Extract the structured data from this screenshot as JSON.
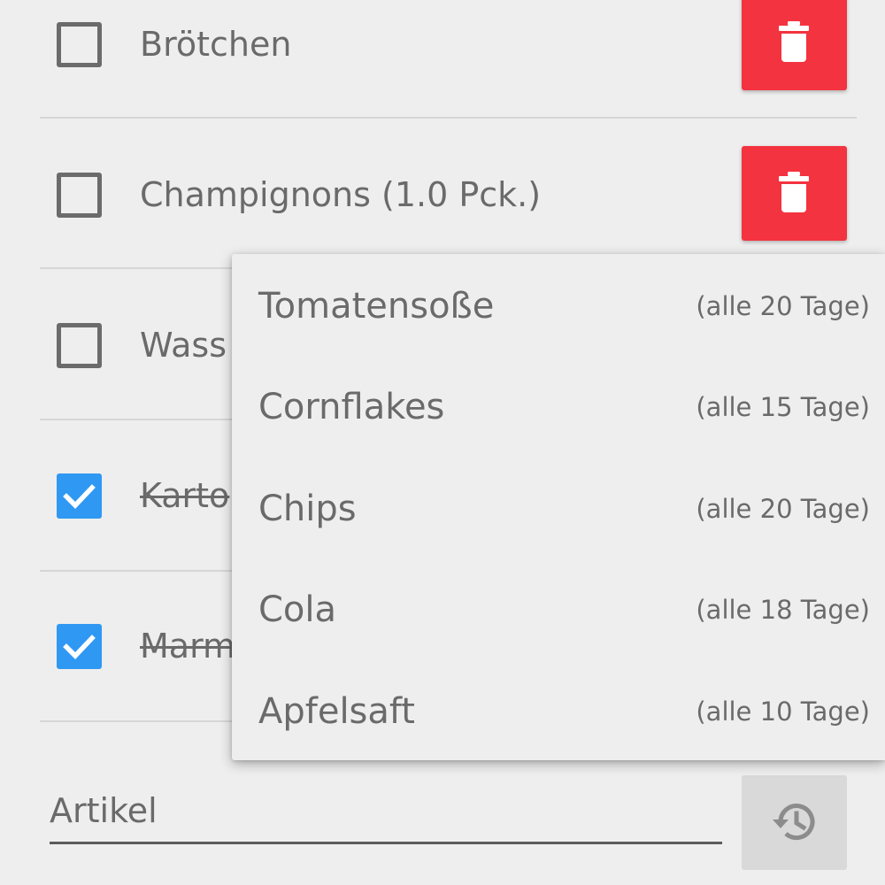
{
  "colors": {
    "background": "#eeeeee",
    "delete_button": "#f3333f",
    "checkbox_checked": "#2f98f3",
    "text": "#6a6a6a",
    "history_button": "#d9d9d9"
  },
  "list": {
    "items": [
      {
        "label": "Brötchen",
        "checked": false
      },
      {
        "label": "Champignons (1.0 Pck.)",
        "checked": false
      },
      {
        "label": "Wass",
        "checked": false
      },
      {
        "label": "Karto",
        "checked": true
      },
      {
        "label": "Marm",
        "checked": true
      }
    ],
    "delete_icon": "trash-icon"
  },
  "input": {
    "placeholder": "Artikel",
    "value": ""
  },
  "history_button": {
    "icon": "history-icon"
  },
  "dropdown": {
    "items": [
      {
        "name": "Tomatensoße",
        "frequency": "(alle 20 Tage)"
      },
      {
        "name": "Cornflakes",
        "frequency": "(alle 15 Tage)"
      },
      {
        "name": "Chips",
        "frequency": "(alle 20 Tage)"
      },
      {
        "name": "Cola",
        "frequency": "(alle 18 Tage)"
      },
      {
        "name": "Apfelsaft",
        "frequency": "(alle 10 Tage)"
      }
    ]
  }
}
